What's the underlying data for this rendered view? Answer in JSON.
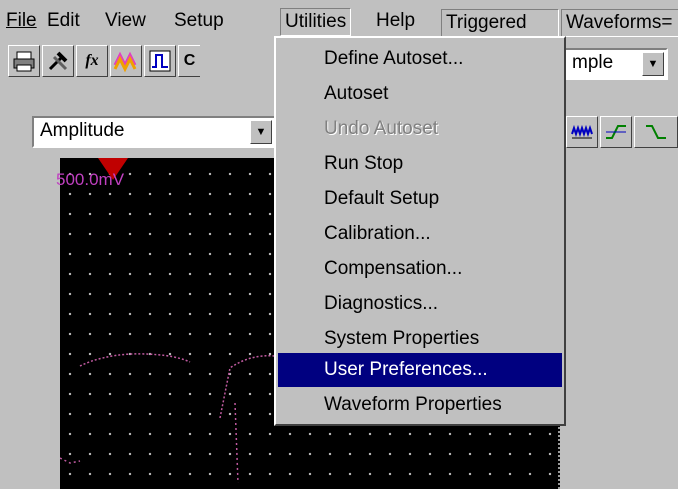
{
  "menubar": {
    "file": "File",
    "edit": "Edit",
    "view": "View",
    "setup": "Setup",
    "utilities": "Utilities",
    "help": "Help",
    "status_triggered": "Triggered",
    "status_waveforms": "Waveforms="
  },
  "toolbar": {
    "fx_label": "fx",
    "c_label": "C",
    "sample_combo": "mple",
    "amplitude_combo": "Amplitude"
  },
  "scope": {
    "channel_scale": "500.0mV"
  },
  "utilities_menu": {
    "items": [
      {
        "label": "Define Autoset...",
        "state": "enabled"
      },
      {
        "label": "Autoset",
        "state": "enabled"
      },
      {
        "label": "Undo Autoset",
        "state": "disabled"
      },
      {
        "label": "Run Stop",
        "state": "enabled"
      },
      {
        "label": "Default Setup",
        "state": "enabled"
      },
      {
        "label": "Calibration...",
        "state": "enabled"
      },
      {
        "label": "Compensation...",
        "state": "enabled"
      },
      {
        "label": "Diagnostics...",
        "state": "enabled"
      },
      {
        "label": "System Properties",
        "state": "enabled"
      },
      {
        "label": "User Preferences...",
        "state": "highlighted"
      },
      {
        "label": "Waveform Properties",
        "state": "enabled"
      }
    ]
  },
  "colors": {
    "menu_highlight": "#000080",
    "scope_background": "#000000",
    "trace": "#c05aa0",
    "channel_label": "#c040c0",
    "marker": "#c00000"
  }
}
